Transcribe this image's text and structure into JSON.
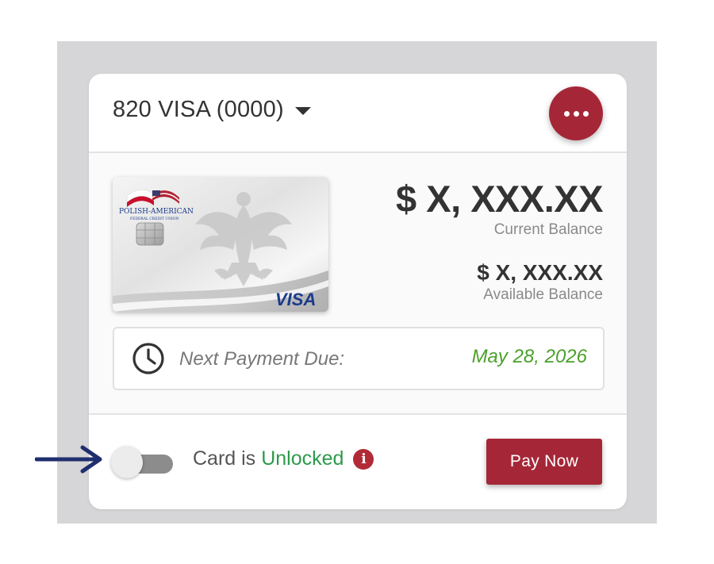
{
  "header": {
    "account_title": "820 VISA (0000)"
  },
  "card": {
    "issuer_name": "POLISH-AMERICAN",
    "issuer_sub": "FEDERAL CREDIT UNION",
    "network": "VISA"
  },
  "balances": {
    "current_amount": "$ X, XXX.XX",
    "current_label": "Current Balance",
    "available_amount": "$ X, XXX.XX",
    "available_label": "Available Balance"
  },
  "payment": {
    "label": "Next Payment Due:",
    "date": "May 28, 2026"
  },
  "lock": {
    "prefix": "Card is",
    "state": "Unlocked",
    "info_glyph": "i"
  },
  "actions": {
    "pay_now_label": "Pay Now"
  },
  "colors": {
    "brand_red": "#a52737",
    "unlocked_green": "#2c9a4a",
    "date_green": "#4aa12a",
    "visa_blue": "#1a3a8a",
    "arrow_navy": "#1f2e6e"
  },
  "icons": {
    "more": "more-horizontal-icon",
    "caret": "chevron-down-icon",
    "clock": "clock-icon",
    "info": "info-icon",
    "pointer": "arrow-right-icon"
  }
}
